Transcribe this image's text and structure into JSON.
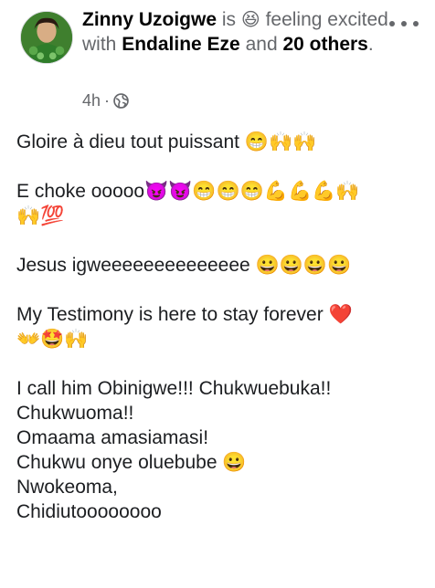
{
  "author": {
    "name": "Zinny Uzoigwe",
    "is_text": "is",
    "feeling_emoji": "😆",
    "feeling_text": "feeling excited with",
    "tag1": "Endaline Eze",
    "and_text": "and",
    "tag2": "20 others",
    "period": "."
  },
  "meta": {
    "time": "4h",
    "separator": "·",
    "privacy_icon": "globe-icon"
  },
  "post": {
    "p1": "Gloire à dieu tout puissant 😁🙌🙌",
    "p2_line1": "E choke ooooo😈😈😁😁😁💪💪💪🙌",
    "p2_line2": "🙌💯",
    "p3": "Jesus igweeeeeeeeeeeeee 😀😀😀😀",
    "p4_line1": "My Testimony is here to stay forever ❤️",
    "p4_line2": "👐🤩🙌",
    "p5_line1": "I call him Obinigwe!!! Chukwuebuka!!",
    "p5_line2": "Chukwuoma!!",
    "p5_line3": "Omaama amasiamasi!",
    "p5_line4": "Chukwu onye oluebube 😀",
    "p5_line5": "Nwokeoma,",
    "p5_line6": "Chidiutoooooooo"
  },
  "colors": {
    "text": "#050505",
    "secondary": "#65676b"
  }
}
